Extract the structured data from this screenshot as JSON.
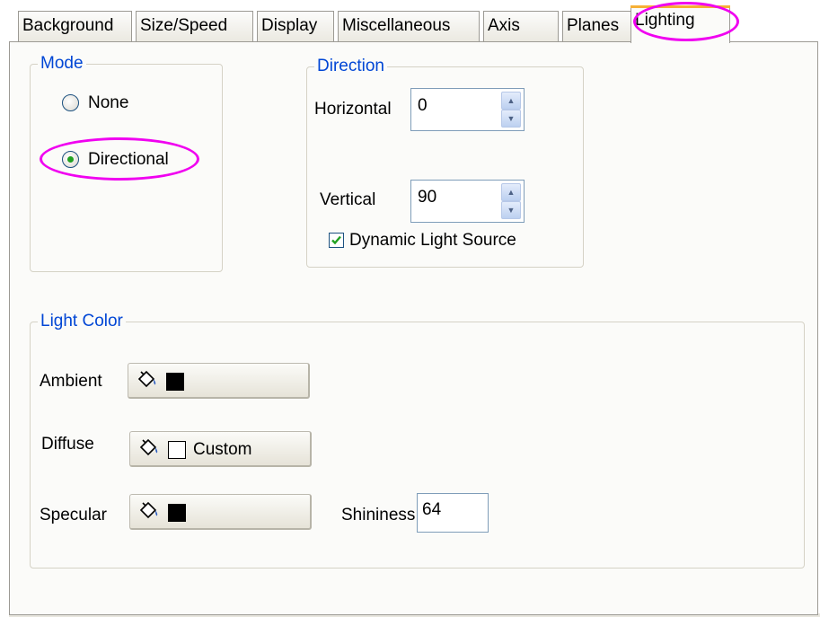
{
  "tabs": [
    {
      "label": "Background"
    },
    {
      "label": "Size/Speed"
    },
    {
      "label": "Display"
    },
    {
      "label": "Miscellaneous"
    },
    {
      "label": "Axis"
    },
    {
      "label": "Planes"
    },
    {
      "label": "Lighting",
      "active": true
    }
  ],
  "mode": {
    "title": "Mode",
    "options": [
      {
        "label": "None",
        "selected": false
      },
      {
        "label": "Directional",
        "selected": true
      }
    ]
  },
  "direction": {
    "title": "Direction",
    "horizontal_label": "Horizontal",
    "horizontal_value": "0",
    "vertical_label": "Vertical",
    "vertical_value": "90",
    "dynamic_label": "Dynamic Light Source",
    "dynamic_checked": true
  },
  "light_color": {
    "title": "Light Color",
    "ambient_label": "Ambient",
    "ambient_color": "#000000",
    "diffuse_label": "Diffuse",
    "diffuse_color": "#ffffff",
    "diffuse_text": "Custom",
    "specular_label": "Specular",
    "specular_color": "#000000",
    "shininess_label": "Shininess",
    "shininess_value": "64"
  },
  "colors": {
    "group_title": "#0046d5",
    "highlight": "#f000f0",
    "active_tab_accent": "#f6b035"
  },
  "icons": {
    "color_picker": "paint-bucket-icon",
    "spin_up": "up-arrow-icon",
    "spin_down": "down-arrow-icon",
    "check": "checkmark-icon"
  }
}
